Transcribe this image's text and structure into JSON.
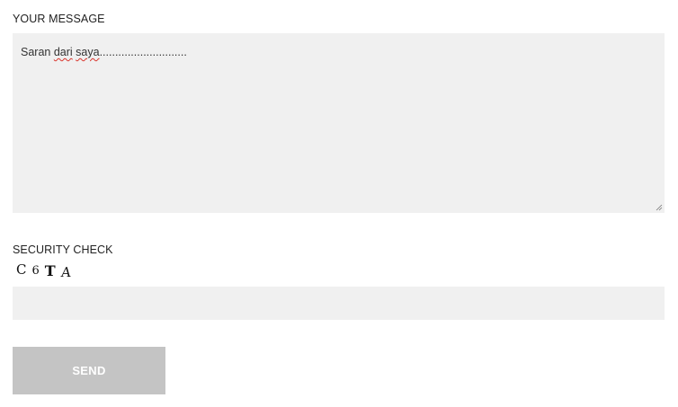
{
  "message": {
    "label": "YOUR MESSAGE",
    "value_word1": "Saran",
    "value_word2": "dari",
    "value_word3": "saya",
    "value_dots": "............................"
  },
  "security": {
    "label": "SECURITY CHECK",
    "captcha": [
      "C",
      "6",
      "T",
      "A"
    ],
    "input_value": ""
  },
  "send": {
    "label": "SEND"
  },
  "icons": {
    "resize": "resize-handle-icon"
  },
  "colors": {
    "field_background": "#f0f0f0",
    "button_background": "#c4c4c4",
    "button_text": "#ffffff",
    "spellcheck_underline": "#d9342b"
  }
}
